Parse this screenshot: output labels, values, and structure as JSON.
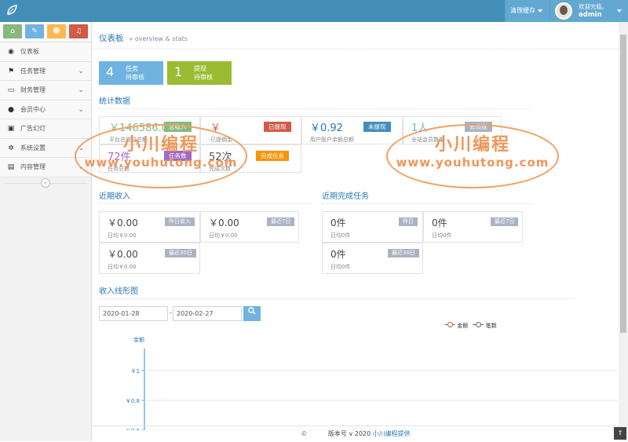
{
  "header": {
    "clear_cache": "清理缓存",
    "welcome": "欢迎光临,",
    "username": "admin"
  },
  "colors": {
    "topbar": "#438eb9",
    "green": "#87b87f",
    "red": "#d15b47",
    "blue": "#438eb9",
    "orange": "#f89406",
    "purple": "#a069c3"
  },
  "sidebar": {
    "items": [
      {
        "label": "仪表板",
        "icon": "dashboard-icon"
      },
      {
        "label": "任务管理",
        "icon": "flag-icon"
      },
      {
        "label": "财务管理",
        "icon": "inbox-icon"
      },
      {
        "label": "会员中心",
        "icon": "user-icon"
      },
      {
        "label": "广告幻灯",
        "icon": "picture-icon"
      },
      {
        "label": "系统设置",
        "icon": "gear-icon"
      },
      {
        "label": "内容管理",
        "icon": "book-icon"
      }
    ]
  },
  "breadcrumb": {
    "title": "仪表板",
    "sub": "» overview & stats"
  },
  "infoboxes": [
    {
      "num": "4",
      "line1": "任务",
      "line2": "待审核"
    },
    {
      "num": "1",
      "line1": "提现",
      "line2": "待审核"
    }
  ],
  "stats": {
    "heading": "统计数据",
    "total_income": {
      "amount": "￥146586.0",
      "tag": "总收入",
      "label": "平台总收益总额"
    },
    "withdrawn": {
      "amount": "￥",
      "tag": "已提现",
      "label": "已提佣金"
    },
    "not_withdrawn": {
      "amount": "￥0.92",
      "tag": "未提现",
      "label": "用户账户余额总额"
    },
    "members": {
      "amount": "1人",
      "tag": "会员数",
      "label": "全站会员数量"
    },
    "tasks": {
      "amount": "72件",
      "tag": "任务数",
      "label": "任务总数"
    },
    "completed": {
      "amount": "52次",
      "tag": "完成任务",
      "label": "完成次数"
    }
  },
  "recent_income": {
    "heading": "近期收入",
    "cards": [
      {
        "amount": "￥0.00",
        "tag": "昨日收入",
        "note": "日均￥0.00"
      },
      {
        "amount": "￥0.00",
        "tag": "最近7日",
        "note": "日均￥0.00"
      },
      {
        "amount": "￥0.00",
        "tag": "最近30日",
        "note": "日均￥0.00"
      }
    ]
  },
  "recent_tasks": {
    "heading": "近期完成任务",
    "cards": [
      {
        "amount": "0件",
        "tag": "昨日",
        "note": "日均0件"
      },
      {
        "amount": "0件",
        "tag": "最近7日",
        "note": "日均0件"
      },
      {
        "amount": "0件",
        "tag": "最近30日",
        "note": "日均0件"
      }
    ]
  },
  "line_chart": {
    "heading": "收入线形图",
    "date_from": "2020-01-28",
    "date_to": "2020-02-27",
    "date_sep": "-"
  },
  "chart_data": {
    "type": "line",
    "ylabel": "金额",
    "legend": [
      "金额",
      "笔数"
    ],
    "yticks": [
      "￥1",
      "￥0.8",
      "￥0.6"
    ],
    "ylim": [
      0.6,
      1
    ]
  },
  "watermark": {
    "line1": "小川编程",
    "line2": "www.youhutong.com"
  },
  "footer": {
    "copyright": "©",
    "version": "版本号 v 2020",
    "provider": "小川编程提供"
  }
}
